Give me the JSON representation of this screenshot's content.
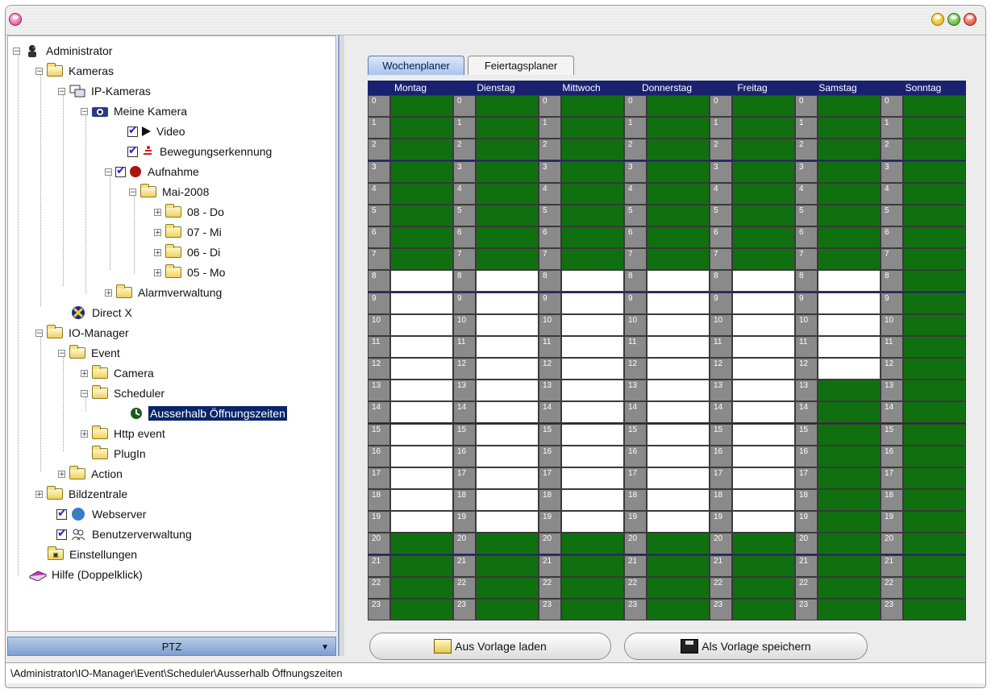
{
  "window": {
    "title": ""
  },
  "tree": {
    "administrator": "Administrator",
    "kameras": "Kameras",
    "ip_kameras": "IP-Kameras",
    "meine_kamera": "Meine Kamera",
    "video": "Video",
    "bewegung": "Bewegungserkennung",
    "aufnahme": "Aufnahme",
    "mai": "Mai-2008",
    "d08": "08 - Do",
    "d07": "07 - Mi",
    "d06": "06 - Di",
    "d05": "05 - Mo",
    "alarm": "Alarmverwaltung",
    "directx": "Direct X",
    "io_manager": "IO-Manager",
    "event": "Event",
    "camera": "Camera",
    "scheduler": "Scheduler",
    "ausserhalb": "Ausserhalb Öffnungszeiten",
    "http_event": "Http event",
    "plugin": "PlugIn",
    "action": "Action",
    "bildzentrale": "Bildzentrale",
    "webserver": "Webserver",
    "benutzer": "Benutzerverwaltung",
    "einstellungen": "Einstellungen",
    "hilfe": "Hilfe (Doppelklick)"
  },
  "ptz": {
    "label": "PTZ"
  },
  "tabs": {
    "wochenplaner": "Wochenplaner",
    "feiertagsplaner": "Feiertagsplaner"
  },
  "schedule": {
    "days": [
      "Montag",
      "Dienstag",
      "Mittwoch",
      "Donnerstag",
      "Freitag",
      "Samstag",
      "Sonntag"
    ],
    "hours": [
      "0",
      "1",
      "2",
      "3",
      "4",
      "5",
      "6",
      "7",
      "8",
      "9",
      "10",
      "11",
      "12",
      "13",
      "14",
      "15",
      "16",
      "17",
      "18",
      "19",
      "20",
      "21",
      "22",
      "23"
    ],
    "active_hours": [
      [
        0,
        1,
        2,
        3,
        4,
        5,
        6,
        7,
        20,
        21,
        22,
        23
      ],
      [
        0,
        1,
        2,
        3,
        4,
        5,
        6,
        7,
        20,
        21,
        22,
        23
      ],
      [
        0,
        1,
        2,
        3,
        4,
        5,
        6,
        7,
        20,
        21,
        22,
        23
      ],
      [
        0,
        1,
        2,
        3,
        4,
        5,
        6,
        7,
        20,
        21,
        22,
        23
      ],
      [
        0,
        1,
        2,
        3,
        4,
        5,
        6,
        7,
        20,
        21,
        22,
        23
      ],
      [
        0,
        1,
        2,
        3,
        4,
        5,
        6,
        7,
        13,
        14,
        15,
        16,
        17,
        18,
        19,
        20,
        21,
        22,
        23
      ],
      [
        0,
        1,
        2,
        3,
        4,
        5,
        6,
        7,
        8,
        9,
        10,
        11,
        12,
        13,
        14,
        15,
        16,
        17,
        18,
        19,
        20,
        21,
        22,
        23
      ]
    ],
    "colors": {
      "active": "#107010",
      "inactive": "#ffffff",
      "header": "#1a2270"
    }
  },
  "buttons": {
    "load": "Aus Vorlage laden",
    "save": "Als Vorlage speichern"
  },
  "status": {
    "path": "\\Administrator\\IO-Manager\\Event\\Scheduler\\Ausserhalb Öffnungszeiten"
  }
}
